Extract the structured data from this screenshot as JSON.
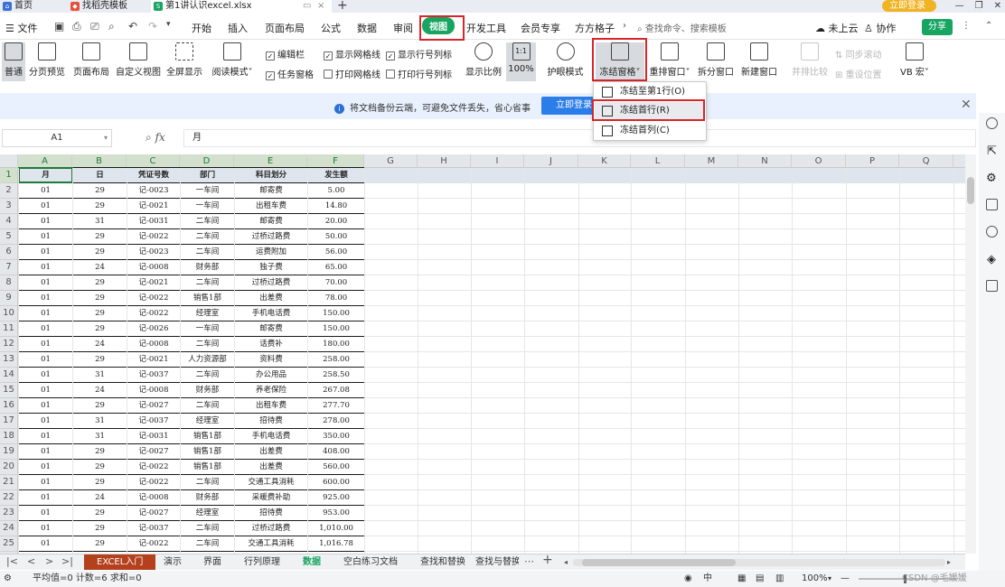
{
  "doc_tabs": [
    {
      "label": "首页",
      "icon": "home-icon"
    },
    {
      "label": "找稻壳模板",
      "icon": "template-icon"
    },
    {
      "label": "第1讲认识excel.xlsx",
      "icon": "spreadsheet-icon"
    }
  ],
  "window": {
    "login_label": "立即登录"
  },
  "menu": {
    "file": "文件",
    "items": [
      "开始",
      "插入",
      "页面布局",
      "公式",
      "数据",
      "审阅",
      "视图",
      "开发工具",
      "会员专享",
      "方方格子"
    ],
    "search": "查找命令、搜索模板",
    "cloud": "未上云",
    "collab": "协作",
    "share": "分享"
  },
  "ribbon": {
    "buttons": [
      {
        "label": "普通"
      },
      {
        "label": "分页预览"
      },
      {
        "label": "页面布局"
      },
      {
        "label": "自定义视图"
      },
      {
        "label": "全屏显示"
      },
      {
        "label": "阅读模式˅"
      }
    ],
    "checks": [
      {
        "label": "编辑栏",
        "checked": true
      },
      {
        "label": "显示网格线",
        "checked": true
      },
      {
        "label": "显示行号列标",
        "checked": true
      },
      {
        "label": "任务窗格",
        "checked": true
      },
      {
        "label": "打印网格线",
        "checked": false
      },
      {
        "label": "打印行号列标",
        "checked": false
      }
    ],
    "zoom_label": "显示比例",
    "zoom100_icon": "1:1",
    "zoom100_label": "100%",
    "eye_label": "护眼模式",
    "freeze_label": "冻结窗格˅",
    "rearrange_label": "重排窗口˅",
    "split_label": "拆分窗口",
    "newwin_label": "新建窗口",
    "compare_label": "并排比较",
    "sync_label": "同步滚动",
    "reset_label": "重设位置",
    "vb_label": "VB 宏˅"
  },
  "dropdown": {
    "items": [
      "冻结至第1行(O)",
      "冻结首行(R)",
      "冻结首列(C)"
    ]
  },
  "banner": {
    "message": "将文档备份云端，可避免文件丢失，省心省事",
    "button": "立即登录"
  },
  "formula": {
    "cell_ref": "A1",
    "fx": "fx",
    "content": "月"
  },
  "sheet": {
    "columns": [
      "A",
      "B",
      "C",
      "D",
      "E",
      "F",
      "G",
      "H",
      "I",
      "J",
      "K",
      "L",
      "M",
      "N",
      "O",
      "P",
      "Q"
    ],
    "header": [
      "月",
      "日",
      "凭证号数",
      "部门",
      "科目划分",
      "发生额"
    ],
    "rows": [
      [
        "01",
        "29",
        "记-0023",
        "一车间",
        "邮寄费",
        "5.00"
      ],
      [
        "01",
        "29",
        "记-0021",
        "一车间",
        "出租车费",
        "14.80"
      ],
      [
        "01",
        "31",
        "记-0031",
        "二车间",
        "邮寄费",
        "20.00"
      ],
      [
        "01",
        "29",
        "记-0022",
        "二车间",
        "过桥过路费",
        "50.00"
      ],
      [
        "01",
        "29",
        "记-0023",
        "二车间",
        "运费附加",
        "56.00"
      ],
      [
        "01",
        "24",
        "记-0008",
        "财务部",
        "独子费",
        "65.00"
      ],
      [
        "01",
        "29",
        "记-0021",
        "二车间",
        "过桥过路费",
        "70.00"
      ],
      [
        "01",
        "29",
        "记-0022",
        "销售1部",
        "出差费",
        "78.00"
      ],
      [
        "01",
        "29",
        "记-0022",
        "经理室",
        "手机电话费",
        "150.00"
      ],
      [
        "01",
        "29",
        "记-0026",
        "一车间",
        "邮寄费",
        "150.00"
      ],
      [
        "01",
        "24",
        "记-0008",
        "二车间",
        "话费补",
        "180.00"
      ],
      [
        "01",
        "29",
        "记-0021",
        "人力资源部",
        "资料费",
        "258.00"
      ],
      [
        "01",
        "31",
        "记-0037",
        "二车间",
        "办公用品",
        "258.50"
      ],
      [
        "01",
        "24",
        "记-0008",
        "财务部",
        "养老保险",
        "267.08"
      ],
      [
        "01",
        "29",
        "记-0027",
        "二车间",
        "出租车费",
        "277.70"
      ],
      [
        "01",
        "31",
        "记-0037",
        "经理室",
        "招待费",
        "278.00"
      ],
      [
        "01",
        "31",
        "记-0031",
        "销售1部",
        "手机电话费",
        "350.00"
      ],
      [
        "01",
        "29",
        "记-0027",
        "销售1部",
        "出差费",
        "408.00"
      ],
      [
        "01",
        "29",
        "记-0022",
        "销售1部",
        "出差费",
        "560.00"
      ],
      [
        "01",
        "29",
        "记-0022",
        "二车间",
        "交通工具消耗",
        "600.00"
      ],
      [
        "01",
        "24",
        "记-0008",
        "财务部",
        "采暖费补助",
        "925.00"
      ],
      [
        "01",
        "29",
        "记-0027",
        "经理室",
        "招待费",
        "953.00"
      ],
      [
        "01",
        "29",
        "记-0037",
        "二车间",
        "过桥过路费",
        "1,010.00"
      ],
      [
        "01",
        "29",
        "记-0022",
        "二车间",
        "交通工具消耗",
        "1,016.78"
      ],
      [
        "01",
        "29",
        "记-0026",
        "二车间",
        "邮寄费",
        "1,046.00"
      ]
    ]
  },
  "sheet_tabs": [
    "EXCEL入门",
    "演示",
    "界面",
    "行列原理",
    "数据",
    "空白练习文档",
    "查找和替换",
    "查找与替换"
  ],
  "status": {
    "summary": "平均值=0  计数=6  求和=0",
    "zoom": "100%",
    "watermark": "CSDN @毛媛媛"
  }
}
